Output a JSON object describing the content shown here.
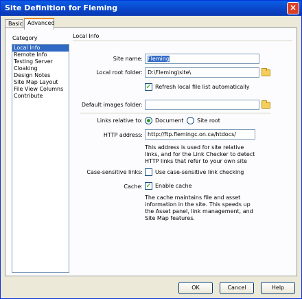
{
  "window": {
    "title": "Site Definition for Fleming",
    "close_glyph": "×"
  },
  "tabs": [
    {
      "label": "Basic"
    },
    {
      "label": "Advanced"
    }
  ],
  "category": {
    "label": "Category",
    "items": [
      "Local Info",
      "Remote Info",
      "Testing Server",
      "Cloaking",
      "Design Notes",
      "Site Map Layout",
      "File View Columns",
      "Contribute"
    ],
    "selected": "Local Info"
  },
  "section": {
    "title": "Local Info"
  },
  "fields": {
    "site_name_label": "Site name:",
    "site_name_value": "Fleming",
    "local_root_label": "Local root folder:",
    "local_root_value": "D:\\Fleming\\site\\",
    "refresh_label": "Refresh local file list automatically",
    "default_images_label": "Default images folder:",
    "default_images_value": "",
    "links_relative_label": "Links relative to:",
    "links_document": "Document",
    "links_siteroot": "Site root",
    "http_label": "HTTP address:",
    "http_value": "http://ftp.flemingc.on.ca/htdocs/",
    "http_help": "This address is used for site relative links, and for the Link Checker to detect HTTP links that refer to your own site",
    "case_label": "Case-sensitive links:",
    "case_check_label": "Use case-sensitive link checking",
    "cache_label": "Cache:",
    "cache_check_label": "Enable cache",
    "cache_help": "The cache maintains file and asset information in the site.  This speeds up the Asset panel, link management, and Site Map features."
  },
  "state": {
    "refresh_checked": true,
    "links_relative": "Document",
    "case_checked": false,
    "cache_checked": true
  },
  "buttons": {
    "ok": "OK",
    "cancel": "Cancel",
    "help": "Help"
  },
  "icons": {
    "folder": "folder-icon",
    "check": "✓"
  }
}
